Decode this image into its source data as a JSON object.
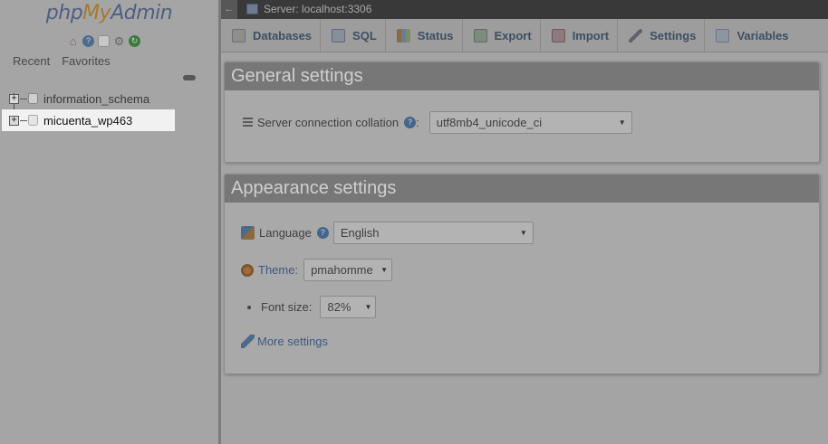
{
  "nav": {
    "logo": {
      "php": "php",
      "my": "My",
      "admin": "Admin"
    },
    "icons": [
      "home-icon",
      "help-icon",
      "docs-icon",
      "settings-gear-icon",
      "reload-icon"
    ],
    "tabs": [
      "Recent",
      "Favorites"
    ],
    "databases": [
      {
        "name": "information_schema",
        "highlighted": false
      },
      {
        "name": "micuenta_wp463",
        "highlighted": true
      }
    ]
  },
  "serverbar": {
    "text": "Server: localhost:3306"
  },
  "menu": {
    "tabs": [
      {
        "label": "Databases",
        "icon": "databases-icon"
      },
      {
        "label": "SQL",
        "icon": "sql-icon"
      },
      {
        "label": "Status",
        "icon": "status-icon"
      },
      {
        "label": "Export",
        "icon": "export-icon"
      },
      {
        "label": "Import",
        "icon": "import-icon"
      },
      {
        "label": "Settings",
        "icon": "settings-icon"
      },
      {
        "label": "Variables",
        "icon": "variables-icon"
      }
    ]
  },
  "general": {
    "title": "General settings",
    "collation_label": "Server connection collation",
    "collation_help": "?",
    "collation_colon": ":",
    "collation_value": "utf8mb4_unicode_ci"
  },
  "appearance": {
    "title": "Appearance settings",
    "language_label": "Language",
    "language_value": "English",
    "theme_label": "Theme:",
    "theme_value": "pmahomme",
    "fontsize_label": "Font size:",
    "fontsize_value": "82%",
    "more_settings": "More settings"
  },
  "colors": {
    "accent": "#3d4f63",
    "overlay": "#a4a4a4",
    "highlight": "#f1f1f1"
  }
}
